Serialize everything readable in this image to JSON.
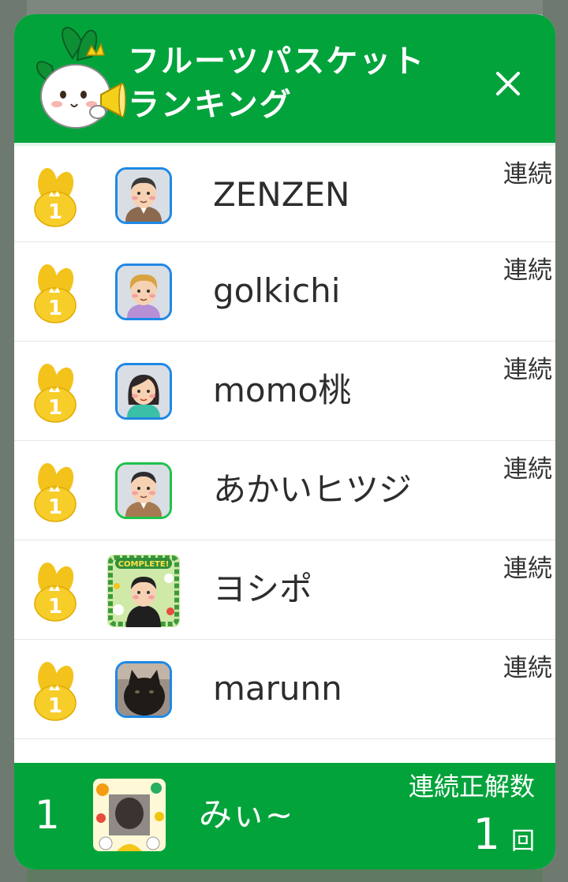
{
  "modal": {
    "title_line1": "フルーツパスケット",
    "title_line2": "ランキング",
    "close_symbol": "✕"
  },
  "colors": {
    "brand_green": "#03a33c",
    "medal_gold": "#f3c31c",
    "avatar_border_blue": "#1e88e5",
    "avatar_border_green": "#1fc24a"
  },
  "ranking": {
    "streak_label": "連続",
    "rows": [
      {
        "rank": "1",
        "name": "ZENZEN",
        "avatar_icon": "man-avatar-icon"
      },
      {
        "rank": "1",
        "name": "golkichi",
        "avatar_icon": "boy-avatar-icon"
      },
      {
        "rank": "1",
        "name": "momo桃",
        "avatar_icon": "woman-avatar-icon"
      },
      {
        "rank": "1",
        "name": "あかいヒツジ",
        "avatar_icon": "man-avatar-icon"
      },
      {
        "rank": "1",
        "name": "ヨシポ",
        "avatar_icon": "complete-badge-avatar-icon",
        "avatar_badge_text": "COMPLETE!"
      },
      {
        "rank": "1",
        "name": "marunn",
        "avatar_icon": "cat-photo-avatar-icon"
      }
    ]
  },
  "my_rank": {
    "rank": "1",
    "name": "みぃ~",
    "streak_label": "連続正解数",
    "count": "1",
    "unit": "回"
  }
}
